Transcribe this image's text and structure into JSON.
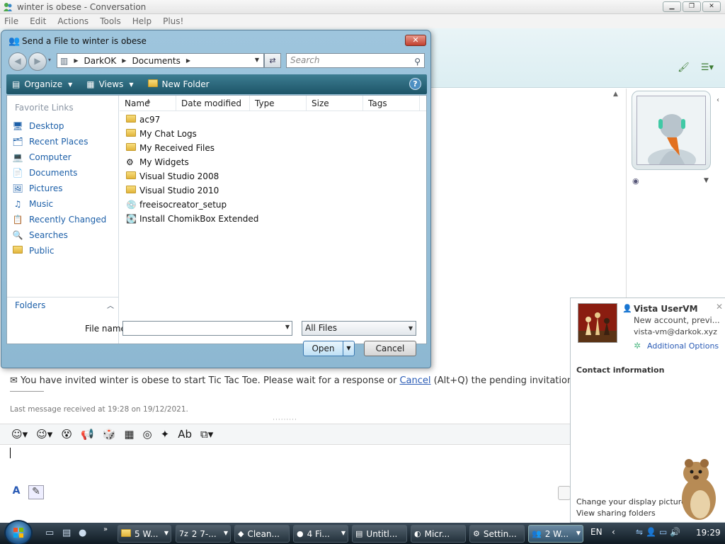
{
  "window": {
    "title": "winter is obese - Conversation",
    "controls": [
      "minimize",
      "restore",
      "close"
    ]
  },
  "menu": [
    "File",
    "Edit",
    "Actions",
    "Tools",
    "Help",
    "Plus!"
  ],
  "conversation": {
    "invite_text_before": "You have invited winter is obese to start Tic Tac Toe. Please wait for a response or",
    "invite_cancel_link": "Cancel",
    "invite_text_after": "(Alt+Q) the pending invitation.",
    "last_message": "Last message received at 19:28 on 19/12/2021.",
    "input_tools": [
      "emoticon-icon",
      "wink-icon",
      "nudge-face-icon",
      "nudge-icon",
      "games-icon",
      "backgrounds-icon",
      "voice-clip-icon",
      "activities-icon",
      "spell-icon",
      "share-icon"
    ],
    "font_tools": [
      "A",
      "pen"
    ]
  },
  "notification": {
    "name": "Vista UserVM",
    "subtitle": "New account, previ...",
    "email": "vista-vm@darkok.xyz",
    "options_link": "Additional Options",
    "contact_info": "Contact information",
    "change_picture": "Change your display picture",
    "sharing_folders": "View sharing folders"
  },
  "dialog": {
    "title": "Send a File to winter is obese",
    "breadcrumb": [
      "DarkOK",
      "Documents"
    ],
    "search_placeholder": "Search",
    "commands": {
      "organize": "Organize",
      "views": "Views",
      "new_folder": "New Folder"
    },
    "favorite_links_title": "Favorite Links",
    "favorite_links": [
      {
        "label": "Desktop",
        "icon": "desktop-icon"
      },
      {
        "label": "Recent Places",
        "icon": "recent-places-icon"
      },
      {
        "label": "Computer",
        "icon": "computer-icon"
      },
      {
        "label": "Documents",
        "icon": "documents-icon"
      },
      {
        "label": "Pictures",
        "icon": "pictures-icon"
      },
      {
        "label": "Music",
        "icon": "music-icon"
      },
      {
        "label": "Recently Changed",
        "icon": "recently-changed-icon"
      },
      {
        "label": "Searches",
        "icon": "searches-icon"
      },
      {
        "label": "Public",
        "icon": "public-folder-icon"
      }
    ],
    "folders_label": "Folders",
    "columns": [
      "Name",
      "Date modified",
      "Type",
      "Size",
      "Tags"
    ],
    "files": [
      {
        "name": "ac97",
        "icon": "folder-icon"
      },
      {
        "name": "My Chat Logs",
        "icon": "folder-icon"
      },
      {
        "name": "My Received Files",
        "icon": "folder-icon"
      },
      {
        "name": "My Widgets",
        "icon": "widgets-folder-icon"
      },
      {
        "name": "Visual Studio 2008",
        "icon": "folder-icon"
      },
      {
        "name": "Visual Studio 2010",
        "icon": "folder-icon"
      },
      {
        "name": "freeisocreator_setup",
        "icon": "setup-icon"
      },
      {
        "name": "Install ChomikBox Extended",
        "icon": "installer-icon"
      }
    ],
    "file_name_label": "File name:",
    "file_name_value": "",
    "file_type": "All Files",
    "open_label": "Open",
    "cancel_label": "Cancel"
  },
  "taskbar": {
    "tasks": [
      {
        "label": "5 W...",
        "icon": "folder-icon",
        "dropdown": true
      },
      {
        "label": "2 7-...",
        "icon": "7zip-icon",
        "dropdown": true
      },
      {
        "label": "Clean...",
        "icon": "app-icon",
        "dropdown": false
      },
      {
        "label": "4 Fi...",
        "icon": "firefox-icon",
        "dropdown": true
      },
      {
        "label": "Untitl...",
        "icon": "notepad-icon",
        "dropdown": false
      },
      {
        "label": "Micr...",
        "icon": "app-icon",
        "dropdown": false
      },
      {
        "label": "Settin...",
        "icon": "settings-icon",
        "dropdown": false
      },
      {
        "label": "2 W...",
        "icon": "messenger-icon",
        "dropdown": true
      }
    ],
    "language": "EN",
    "clock": "19:29"
  }
}
